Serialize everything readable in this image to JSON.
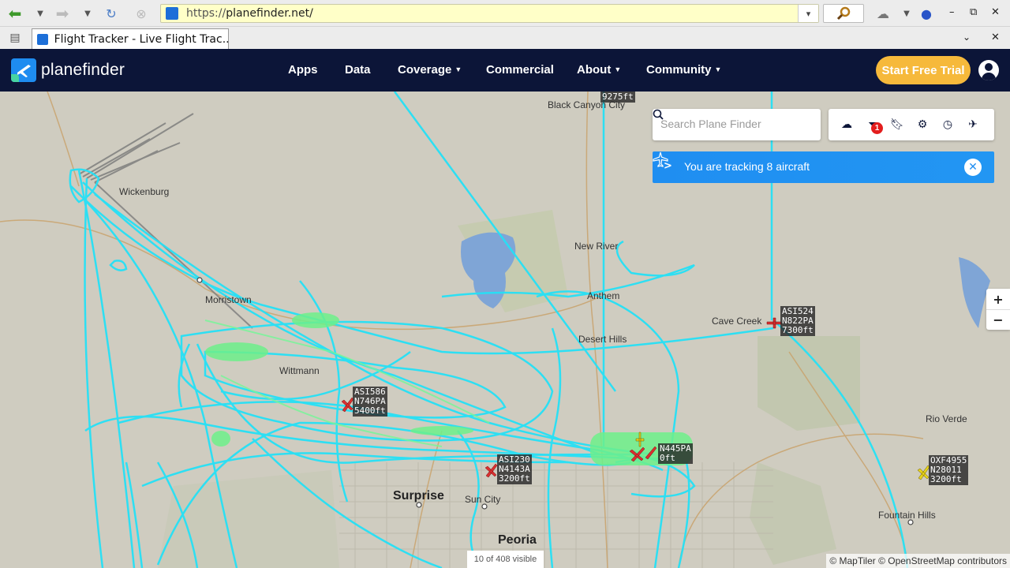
{
  "browser": {
    "url_prefix": "https://",
    "url_host": "planefinder.net/",
    "tab_title": "Flight Tracker - Live Flight Trac..."
  },
  "site": {
    "logo_text": "planefinder",
    "nav": [
      {
        "label": "Apps",
        "has_menu": false
      },
      {
        "label": "Data",
        "has_menu": false
      },
      {
        "label": "Coverage",
        "has_menu": true
      },
      {
        "label": "Commercial",
        "has_menu": false
      },
      {
        "label": "About",
        "has_menu": true
      },
      {
        "label": "Community",
        "has_menu": true
      }
    ],
    "trial_button": "Start Free Trial",
    "brand_color": "#0c1538",
    "accent_color": "#f6b93b"
  },
  "map": {
    "search_placeholder": "Search Plane Finder",
    "filter_badge": "1",
    "tracking_text": "You are tracking 8 aircraft",
    "zoom_in": "+",
    "zoom_out": "−",
    "visible_count": "10 of 408 visible",
    "attribution": "© MapTiler © OpenStreetMap contributors",
    "places": [
      {
        "name": "Black Canyon City",
        "size": "small"
      },
      {
        "name": "Wickenburg",
        "size": "small"
      },
      {
        "name": "New River",
        "size": "small"
      },
      {
        "name": "Anthem",
        "size": "small"
      },
      {
        "name": "Cave Creek",
        "size": "small"
      },
      {
        "name": "Desert Hills",
        "size": "small"
      },
      {
        "name": "Morristown",
        "size": "small"
      },
      {
        "name": "Wittmann",
        "size": "small"
      },
      {
        "name": "Rio Verde",
        "size": "small"
      },
      {
        "name": "Surprise",
        "size": "large"
      },
      {
        "name": "Sun City",
        "size": "small"
      },
      {
        "name": "Peoria",
        "size": "large"
      },
      {
        "name": "Fountain Hills",
        "size": "small"
      }
    ],
    "aircraft": [
      {
        "lines": [
          "9275ft"
        ]
      },
      {
        "lines": [
          "ASI524",
          "N822PA",
          "7300ft"
        ]
      },
      {
        "lines": [
          "ASI586",
          "N746PA",
          "5400ft"
        ]
      },
      {
        "lines": [
          "N445PA",
          "0ft"
        ]
      },
      {
        "lines": [
          "ASI230",
          "N4143A",
          "3200ft"
        ]
      },
      {
        "lines": [
          "OXF4955",
          "N28011",
          "3200ft"
        ]
      }
    ]
  }
}
